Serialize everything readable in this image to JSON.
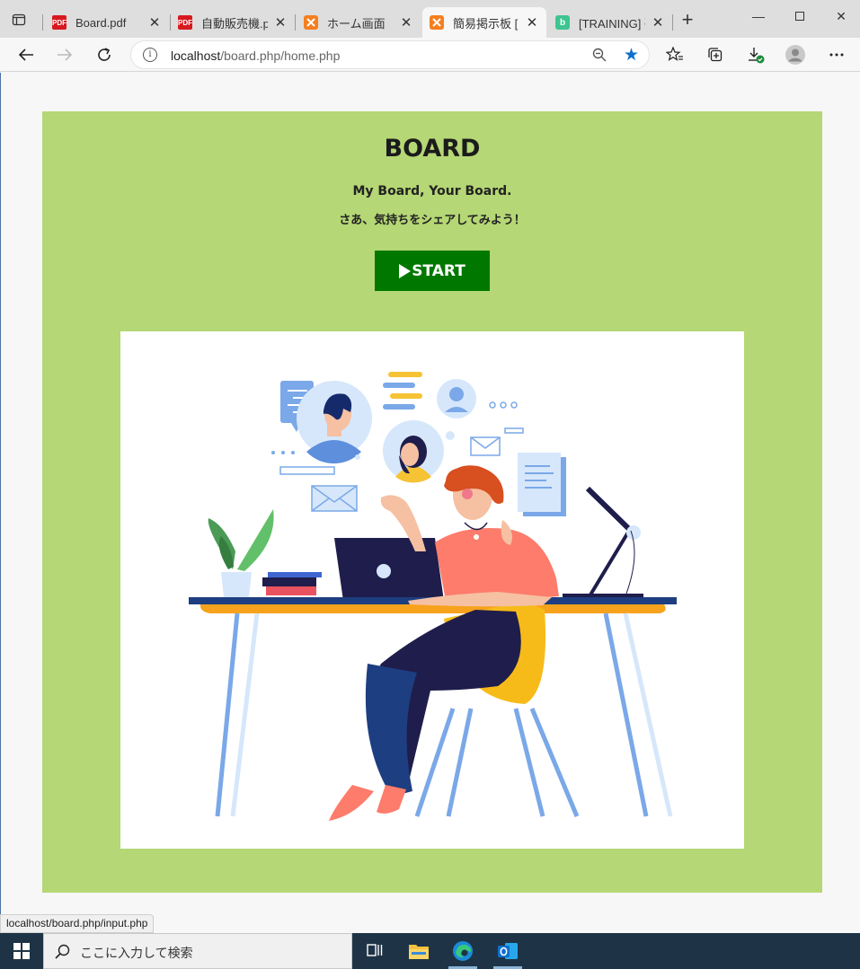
{
  "browser": {
    "tabs": [
      {
        "title": "Board.pdf",
        "icon": "pdf-icon",
        "active": false
      },
      {
        "title": "自動販売機.pd",
        "icon": "pdf-icon",
        "active": false
      },
      {
        "title": "ホーム画面",
        "icon": "xampp-icon",
        "active": false
      },
      {
        "title": "簡易掲示板 [",
        "icon": "xampp-icon",
        "active": true
      },
      {
        "title": "[TRAINING] 研",
        "icon": "b-icon",
        "active": false
      }
    ],
    "address": {
      "host": "localhost",
      "path": "/board.php/home.php"
    },
    "status_url": "localhost/board.php/input.php"
  },
  "page": {
    "title": "BOARD",
    "tagline": "My Board, Your Board.",
    "tagline_jp": "さあ、気持ちをシェアしてみよう！",
    "start_button": "START"
  },
  "taskbar": {
    "search_placeholder": "ここに入力して検索"
  },
  "colors": {
    "card_bg": "#b5d775",
    "start_bg": "#007800",
    "accent_star": "#0f6ecd"
  }
}
